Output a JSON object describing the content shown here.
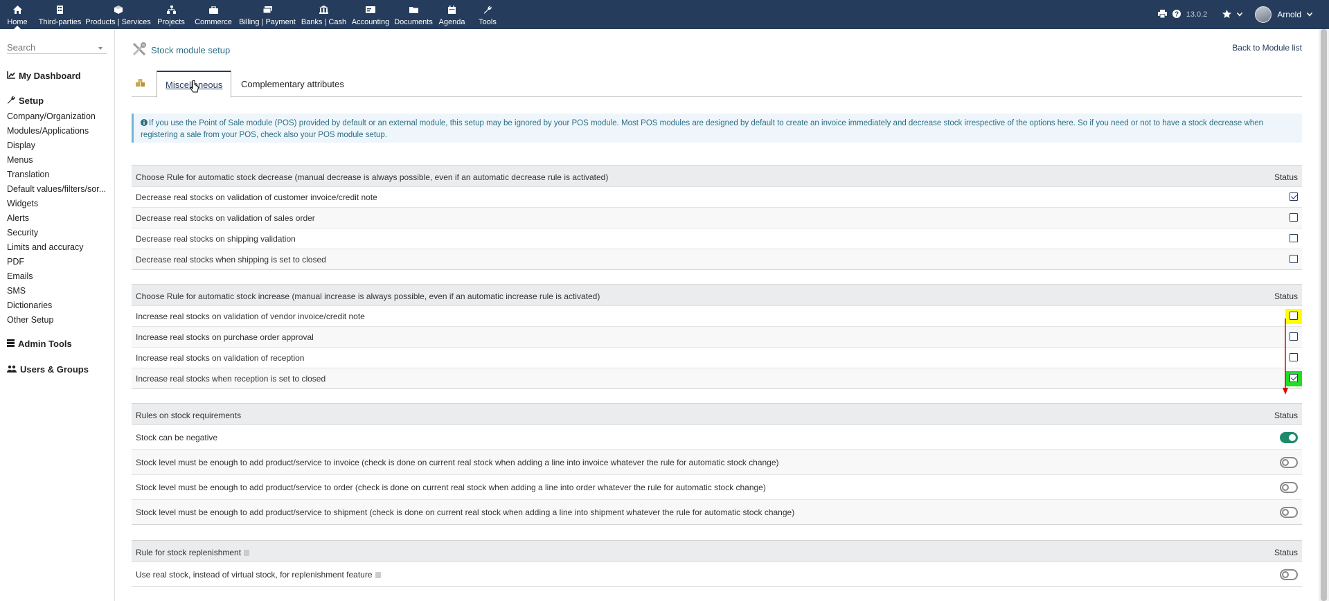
{
  "nav": [
    {
      "label": "Home",
      "icon": "home-icon"
    },
    {
      "label": "Third-parties",
      "icon": "building-icon"
    },
    {
      "label": "Products | Services",
      "icon": "cube-icon"
    },
    {
      "label": "Projects",
      "icon": "sitemap-icon"
    },
    {
      "label": "Commerce",
      "icon": "briefcase-icon"
    },
    {
      "label": "Billing | Payment",
      "icon": "money-icon"
    },
    {
      "label": "Banks | Cash",
      "icon": "bank-icon"
    },
    {
      "label": "Accounting",
      "icon": "money-check-icon"
    },
    {
      "label": "Documents",
      "icon": "folder-icon"
    },
    {
      "label": "Agenda",
      "icon": "calendar-icon"
    },
    {
      "label": "Tools",
      "icon": "wrench-icon"
    }
  ],
  "topright": {
    "version": "13.0.2",
    "user": "Arnold"
  },
  "sidebar": {
    "search_placeholder": "Search",
    "dashboard": "My Dashboard",
    "setup": "Setup",
    "setup_items": [
      "Company/Organization",
      "Modules/Applications",
      "Display",
      "Menus",
      "Translation",
      "Default values/filters/sor...",
      "Widgets",
      "Alerts",
      "Security",
      "Limits and accuracy",
      "PDF",
      "Emails",
      "SMS",
      "Dictionaries",
      "Other Setup"
    ],
    "admin_tools": "Admin Tools",
    "users_groups": "Users & Groups"
  },
  "page": {
    "title": "Stock module setup",
    "back": "Back to Module list",
    "tabs": [
      "Miscellaneous",
      "Complementary attributes"
    ],
    "info": "If you use the Point of Sale module (POS) provided by default or an external module, this setup may be ignored by your POS module. Most POS modules are designed by default to create an invoice immediately and decrease stock irrespective of the options here. So if you need or not to have a stock decrease when registering a sale from your POS, check also your POS module setup."
  },
  "status_label": "Status",
  "decrease": {
    "header": "Choose Rule for automatic stock decrease (manual decrease is always possible, even if an automatic decrease rule is activated)",
    "rows": [
      {
        "label": "Decrease real stocks on validation of customer invoice/credit note",
        "checked": true
      },
      {
        "label": "Decrease real stocks on validation of sales order",
        "checked": false
      },
      {
        "label": "Decrease real stocks on shipping validation",
        "checked": false
      },
      {
        "label": "Decrease real stocks when shipping is set to closed",
        "checked": false
      }
    ]
  },
  "increase": {
    "header": "Choose Rule for automatic stock increase (manual increase is always possible, even if an automatic increase rule is activated)",
    "rows": [
      {
        "label": "Increase real stocks on validation of vendor invoice/credit note",
        "checked": false
      },
      {
        "label": "Increase real stocks on purchase order approval",
        "checked": false
      },
      {
        "label": "Increase real stocks on validation of reception",
        "checked": false
      },
      {
        "label": "Increase real stocks when reception is set to closed",
        "checked": true
      }
    ]
  },
  "requirements": {
    "header": "Rules on stock requirements",
    "rows": [
      {
        "label": "Stock can be negative",
        "on": true
      },
      {
        "label": "Stock level must be enough to add product/service to invoice (check is done on current real stock when adding a line into invoice whatever the rule for automatic stock change)",
        "on": false
      },
      {
        "label": "Stock level must be enough to add product/service to order (check is done on current real stock when adding a line into order whatever the rule for automatic stock change)",
        "on": false
      },
      {
        "label": "Stock level must be enough to add product/service to shipment (check is done on current real stock when adding a line into shipment whatever the rule for automatic stock change)",
        "on": false
      }
    ]
  },
  "replenish": {
    "header": "Rule for stock replenishment",
    "rows": [
      {
        "label": "Use real stock, instead of virtual stock, for replenishment feature",
        "on": false
      }
    ]
  },
  "colors": {
    "topbar": "#263c5c",
    "highlight_yellow": "#ffff00",
    "highlight_green": "#22dd22",
    "toggle_on": "#1c8a6d",
    "arrow": "#e00000"
  }
}
